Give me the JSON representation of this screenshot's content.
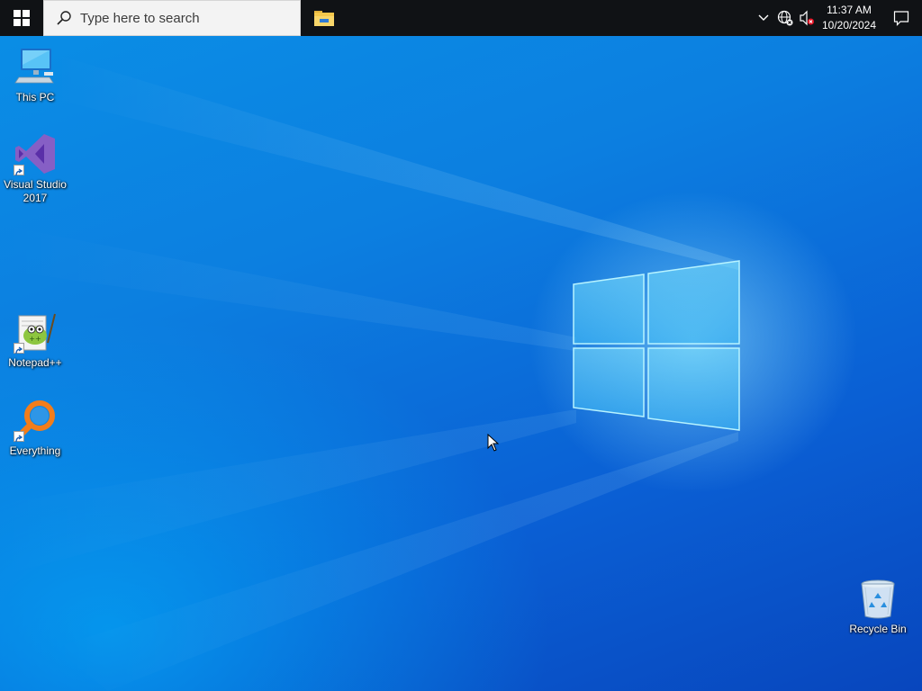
{
  "taskbar": {
    "start_icon": "windows-logo-icon",
    "search_placeholder": "Type here to search",
    "pinned": [
      {
        "name": "File Explorer",
        "icon": "folder-icon"
      }
    ],
    "tray": {
      "icons": [
        "chevron-up-icon",
        "network-icon",
        "volume-muted-icon"
      ],
      "time": "11:37 AM",
      "date": "10/20/2024",
      "notification_icon": "action-center-icon"
    }
  },
  "desktop": {
    "icons": [
      {
        "label": "This PC",
        "icon": "computer-icon"
      },
      {
        "label": "Visual Studio\n2017",
        "icon": "visual-studio-icon",
        "shortcut": true
      },
      {
        "label": "Notepad++",
        "icon": "notepad-plus-plus-icon",
        "shortcut": true
      },
      {
        "label": "Everything",
        "icon": "search-magnifier-icon",
        "shortcut": true
      },
      {
        "label": "Recycle Bin",
        "icon": "recycle-bin-icon"
      }
    ]
  },
  "colors": {
    "taskbar_bg": "#101215",
    "desktop_blue": "#0a7fe0",
    "search_bg": "#f3f3f3"
  }
}
